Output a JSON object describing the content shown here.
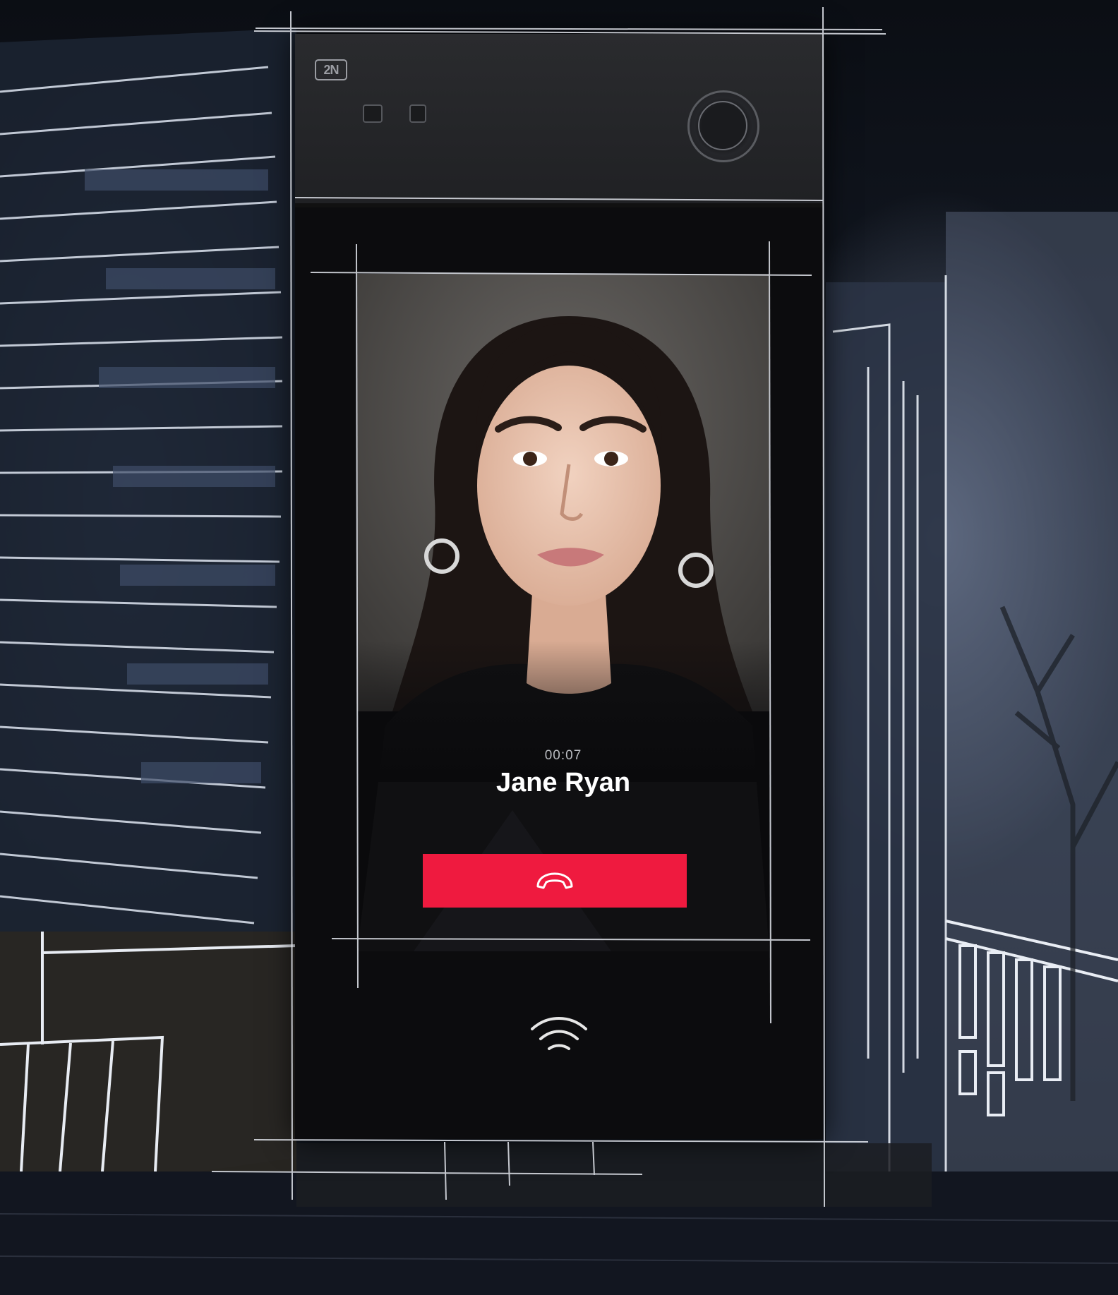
{
  "device": {
    "brand_logo": "2N",
    "call": {
      "timer": "00:07",
      "caller_name": "Jane Ryan"
    },
    "icons": {
      "hangup": "phone-hangup-icon",
      "nfc": "contactless-wave-icon",
      "camera": "camera-lens-icon"
    }
  },
  "colors": {
    "hangup_button": "#ef1a3f",
    "device_body": "#202124",
    "screen_bg": "#0a0a0c",
    "name_text": "#ffffff"
  }
}
